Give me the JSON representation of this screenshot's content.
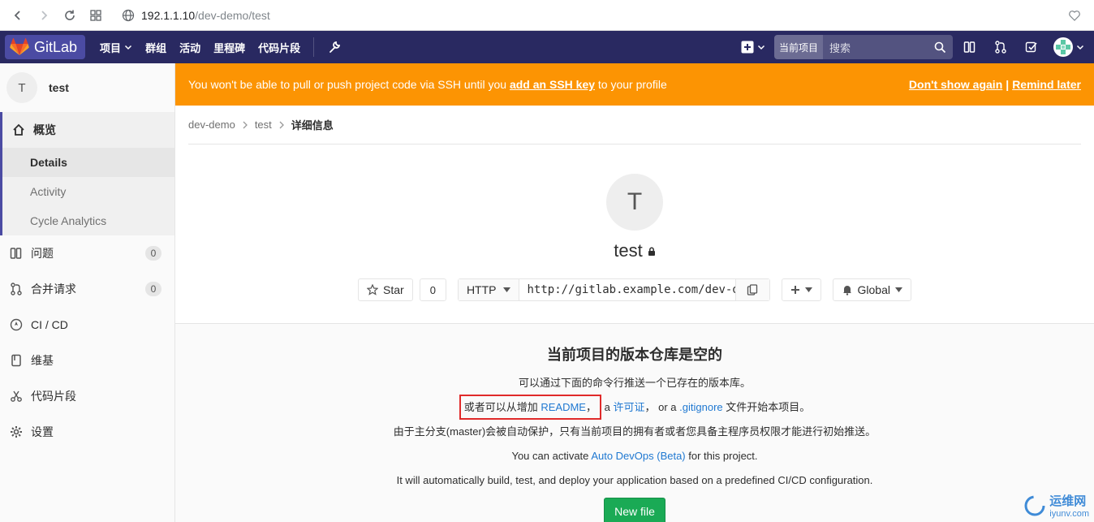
{
  "browser": {
    "url_host": "192.1.1.10",
    "url_path": "/dev-demo/test"
  },
  "navbar": {
    "brand": "GitLab",
    "items": [
      "项目",
      "群组",
      "活动",
      "里程碑",
      "代码片段"
    ],
    "search_scope": "当前项目",
    "search_placeholder": "搜索"
  },
  "sidebar": {
    "project_initial": "T",
    "project_name": "test",
    "overview": "概览",
    "sub_items": [
      "Details",
      "Activity",
      "Cycle Analytics"
    ],
    "issues": "问题",
    "issues_count": "0",
    "merge_requests": "合并请求",
    "merge_requests_count": "0",
    "cicd": "CI / CD",
    "wiki": "维基",
    "snippets": "代码片段",
    "settings": "设置"
  },
  "alert": {
    "text_before": "You won't be able to pull or push project code via SSH until you ",
    "link": "add an SSH key",
    "text_after": " to your profile",
    "dont_show": "Don't show again",
    "separator": "|",
    "remind": "Remind later"
  },
  "breadcrumb": [
    "dev-demo",
    "test",
    "详细信息"
  ],
  "project": {
    "initial": "T",
    "title": "test",
    "star_label": "Star",
    "star_count": "0",
    "protocol": "HTTP",
    "clone_url": "http://gitlab.example.com/dev-de",
    "notification": "Global"
  },
  "empty": {
    "heading": "当前项目的版本仓库是空的",
    "line1": "可以通过下面的命令行推送一个已存在的版本库。",
    "line2_prefix": "或者可以从增加",
    "readme": "README",
    "comma1": "，",
    "a1": "a",
    "license": "许可证",
    "comma2": "，",
    "or_a": "or a",
    "gitignore": ".gitignore",
    "line2_suffix": "文件开始本项目。",
    "line3": "由于主分支(master)会被自动保护，只有当前项目的拥有者或者您具备主程序员权限才能进行初始推送。",
    "line4_prefix": "You can activate",
    "autodevops": "Auto DevOps (Beta)",
    "line4_suffix": "for this project.",
    "line5": "It will automatically build, test, and deploy your application based on a predefined CI/CD configuration.",
    "new_file": "New file"
  },
  "watermark": {
    "line1": "运维网",
    "line2": "iyunv.com"
  },
  "colors": {
    "navbar": "#292961",
    "alert": "#fc9403",
    "link": "#1f78d1",
    "success": "#1aaa55",
    "highlight": "#e02a2a"
  }
}
